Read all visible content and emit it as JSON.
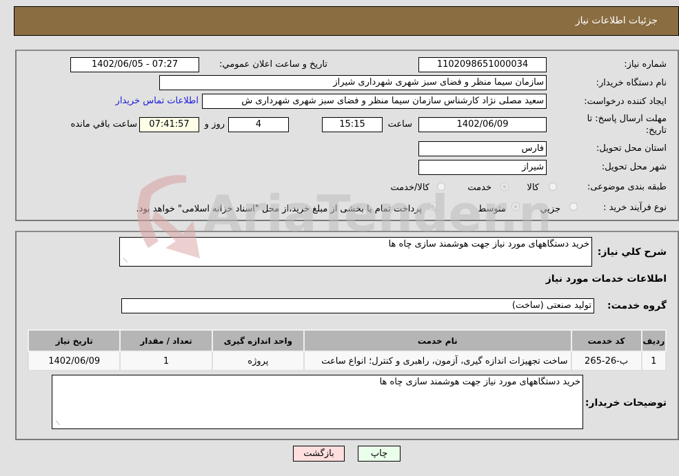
{
  "header": {
    "title": "جزئیات اطلاعات نیاز"
  },
  "form": {
    "need_number": {
      "label": "شماره نیاز:",
      "value": "1102098651000034"
    },
    "announce_datetime": {
      "label": "تاریخ و ساعت اعلان عمومي:",
      "value": "1402/06/05 - 07:27"
    },
    "buyer_org": {
      "label": "نام دستگاه خریدار:",
      "value": "سازمان سیما منظر و فضای سبز شهری شهرداری شیراز"
    },
    "requester": {
      "label": "ایجاد کننده درخواست:",
      "value": "سعید مصلی نژاد کارشناس سازمان سیما منظر و فضای سبز شهری شهرداری ش",
      "contact_link": "اطلاعات تماس خریدار"
    },
    "deadline": {
      "label_line1": "مهلت ارسال پاسخ: تا",
      "label_line2": "تاریخ:",
      "date": "1402/06/09",
      "time_label": "ساعت",
      "time": "15:15",
      "days": "4",
      "days_label": "روز و",
      "remaining": "07:41:57",
      "remaining_label": "ساعت باقي مانده"
    },
    "province": {
      "label": "استان محل تحویل:",
      "value": "فارس"
    },
    "city": {
      "label": "شهر محل تحویل:",
      "value": "شیراز"
    },
    "category": {
      "label": "طبقه بندی موضوعی:",
      "options": [
        "کالا",
        "خدمت",
        "کالا/خدمت"
      ],
      "selected": "خدمت"
    },
    "purchase_type": {
      "label": "نوع فرآیند خرید :",
      "options": [
        "جزیي",
        "متوسط"
      ],
      "selected": "متوسط",
      "treasury_note": "پرداخت تمام یا بخشی از مبلغ خرید،از محل \"اسناد خزانه اسلامی\" خواهد بود."
    }
  },
  "details": {
    "general_desc_label": "شرح کلي نیاز:",
    "general_desc": "خرید دستگاههای مورد نیاز جهت هوشمند سازی چاه ها",
    "services_heading": "اطلاعات خدمات مورد نیاز",
    "service_group_label": "گروه خدمت:",
    "service_group": "تولید صنعتی (ساخت)",
    "table": {
      "headers": [
        "ردیف",
        "کد خدمت",
        "نام خدمت",
        "واحد اندازه گیری",
        "تعداد / مقدار",
        "تاریخ نیاز"
      ],
      "rows": [
        [
          "1",
          "ب-26-265",
          "ساخت تجهیزات اندازه گیری، آزمون، راهبری و کنترل؛ انواع ساعت",
          "پروژه",
          "1",
          "1402/06/09"
        ]
      ]
    },
    "buyer_notes_label": "توضیحات خریدار:",
    "buyer_notes": "خرید دستگاههای مورد نیاز جهت هوشمند سازی چاه ها"
  },
  "buttons": {
    "print": "چاپ",
    "back": "بازگشت"
  },
  "watermark": {
    "text": "AriaTender.neT"
  },
  "colors": {
    "header_bg": "#8b6d42",
    "link": "#1a1adb",
    "print_bg": "#eaffea",
    "back_bg": "#ffdede",
    "remaining_bg": "#ffffe8"
  }
}
